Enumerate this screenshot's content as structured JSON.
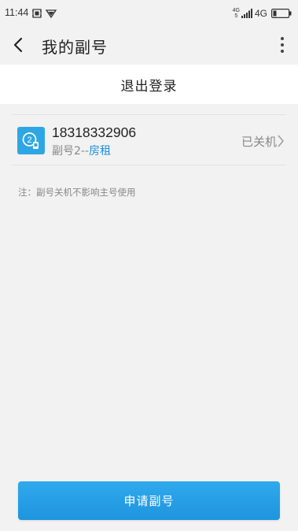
{
  "status_bar": {
    "time": "11:44",
    "net_top": "4G",
    "net_bottom": "5",
    "network": "4G"
  },
  "app_bar": {
    "title": "我的副号",
    "back_icon": "chevron-left-icon",
    "menu_icon": "more-vertical-icon"
  },
  "logout": {
    "label": "退出登录"
  },
  "sub_number": {
    "number": "18318332906",
    "label_prefix": "副号2--",
    "label_tag": "房租",
    "status": "已关机",
    "avatar_icon": "sub-number-2-icon"
  },
  "note": "注：副号关机不影响主号使用",
  "apply_button": {
    "label": "申请副号"
  },
  "colors": {
    "accent": "#2fa6e4",
    "tag": "#1e8fe1",
    "background": "#f2f2f2"
  }
}
